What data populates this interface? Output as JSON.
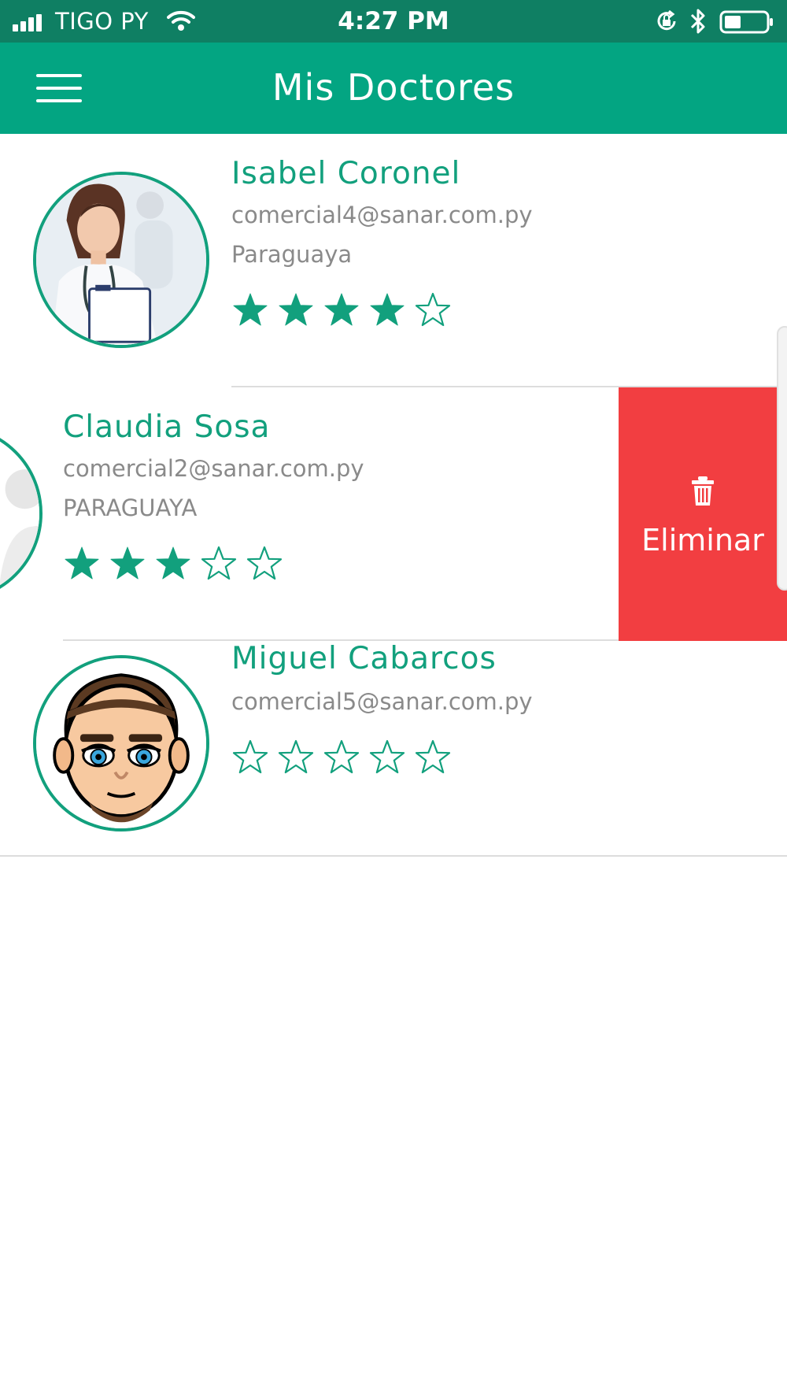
{
  "status_bar": {
    "carrier": "TIGO PY",
    "time": "4:27 PM",
    "icons": [
      "signal-icon",
      "wifi-icon",
      "rotation-lock-icon",
      "bluetooth-icon",
      "battery-icon"
    ]
  },
  "header": {
    "title": "Mis Doctores",
    "menu_icon": "hamburger-menu-icon",
    "background": "#03a582"
  },
  "colors": {
    "accent": "#12a07d",
    "status_bar": "#0f7f63",
    "delete": "#f23e41",
    "secondary_text": "#8a8a8a"
  },
  "doctors": [
    {
      "name": "Isabel Coronel",
      "email": "comercial4@sanar.com.py",
      "country": "Paraguaya",
      "rating": 4,
      "max_rating": 5
    },
    {
      "name": "Claudia Sosa",
      "email": "comercial2@sanar.com.py",
      "country": "PARAGUAYA",
      "rating": 3,
      "max_rating": 5,
      "swipe_action": {
        "label": "Eliminar",
        "icon": "trash-icon"
      }
    },
    {
      "name": "Miguel Cabarcos",
      "email": "comercial5@sanar.com.py",
      "country": "",
      "rating": 0,
      "max_rating": 5
    }
  ]
}
